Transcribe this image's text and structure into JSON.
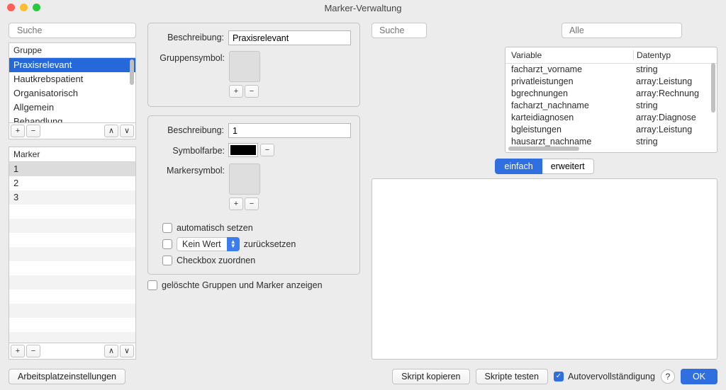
{
  "window": {
    "title": "Marker-Verwaltung"
  },
  "left": {
    "search_placeholder": "Suche",
    "gruppe_header": "Gruppe",
    "gruppe_items": [
      "Praxisrelevant",
      "Hautkrebspatient",
      "Organisatorisch",
      "Allgemein",
      "Behandlung"
    ],
    "gruppe_selected_index": 0,
    "marker_header": "Marker",
    "marker_items": [
      "1",
      "2",
      "3"
    ],
    "marker_selected_index": 0,
    "add": "+",
    "remove": "−",
    "up": "∧",
    "down": "∨"
  },
  "mid": {
    "beschreibung_label": "Beschreibung:",
    "gruppe_beschreibung_value": "Praxisrelevant",
    "gruppensymbol_label": "Gruppensymbol:",
    "marker_beschreibung_value": "1",
    "symbolfarbe_label": "Symbolfarbe:",
    "markersymbol_label": "Markersymbol:",
    "auto_label": "automatisch setzen",
    "reset_popup": "Kein Wert",
    "reset_label": "zurücksetzen",
    "checkbox_assign_label": "Checkbox zuordnen",
    "show_deleted_label": "gelöschte Gruppen und Marker anzeigen"
  },
  "right": {
    "search_placeholder": "Suche",
    "filter_placeholder": "Alle",
    "var_col1": "Variable",
    "var_col2": "Datentyp",
    "variables": [
      {
        "name": "facharzt_vorname",
        "type": "string"
      },
      {
        "name": "privatleistungen",
        "type": "array:Leistung"
      },
      {
        "name": "bgrechnungen",
        "type": "array:Rechnung"
      },
      {
        "name": "facharzt_nachname",
        "type": "string"
      },
      {
        "name": "karteidiagnosen",
        "type": "array:Diagnose"
      },
      {
        "name": "bgleistungen",
        "type": "array:Leistung"
      },
      {
        "name": "hausarzt_nachname",
        "type": "string"
      }
    ],
    "tab_simple": "einfach",
    "tab_advanced": "erweitert"
  },
  "bottom": {
    "workplace_settings": "Arbeitsplatzeinstellungen",
    "copy_script": "Skript kopieren",
    "test_scripts": "Skripte testen",
    "autocomplete": "Autovervollständigung",
    "help": "?",
    "ok": "OK"
  }
}
